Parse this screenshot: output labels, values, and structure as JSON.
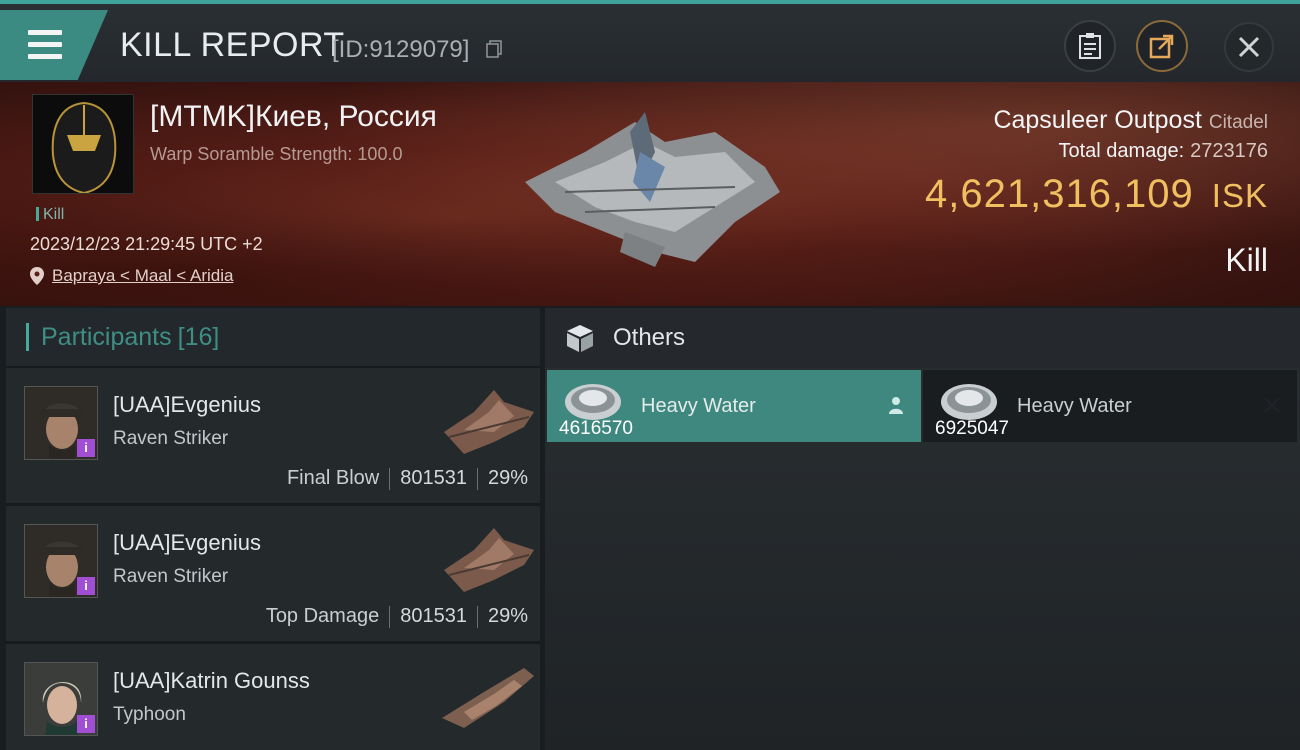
{
  "header": {
    "title": "KILL REPORT",
    "report_id": "[ID:9129079]"
  },
  "victim": {
    "name": "[MTMK]Киев, Россия",
    "subtitle": "Warp Soramble Strength: 100.0",
    "tag": "Kill",
    "datetime": "2023/12/23 21:29:45 UTC +2",
    "location": "Bapraya < Maal < Aridia"
  },
  "target": {
    "name": "Capsuleer Outpost",
    "class": "Citadel",
    "total_damage_label": "Total damage:",
    "total_damage_value": "2723176",
    "isk_value": "4,621,316,109",
    "isk_unit": "ISK",
    "result": "Kill"
  },
  "participants": {
    "title": "Participants",
    "count": "[16]",
    "rows": [
      {
        "name": "[UAA]Evgenius",
        "ship": "Raven Striker",
        "label": "Final Blow",
        "damage": "801531",
        "percent": "29%"
      },
      {
        "name": "[UAA]Evgenius",
        "ship": "Raven Striker",
        "label": "Top Damage",
        "damage": "801531",
        "percent": "29%"
      },
      {
        "name": "[UAA]Katrin Gounss",
        "ship": "Typhoon",
        "label": "",
        "damage": "",
        "percent": ""
      }
    ]
  },
  "others": {
    "title": "Others",
    "items": [
      {
        "name": "Heavy Water",
        "qty": "4616570"
      },
      {
        "name": "Heavy Water",
        "qty": "6925047"
      }
    ]
  },
  "colors": {
    "accent": "#3f8880",
    "isk": "#f0c060",
    "hero_bg": "#5c2018"
  }
}
